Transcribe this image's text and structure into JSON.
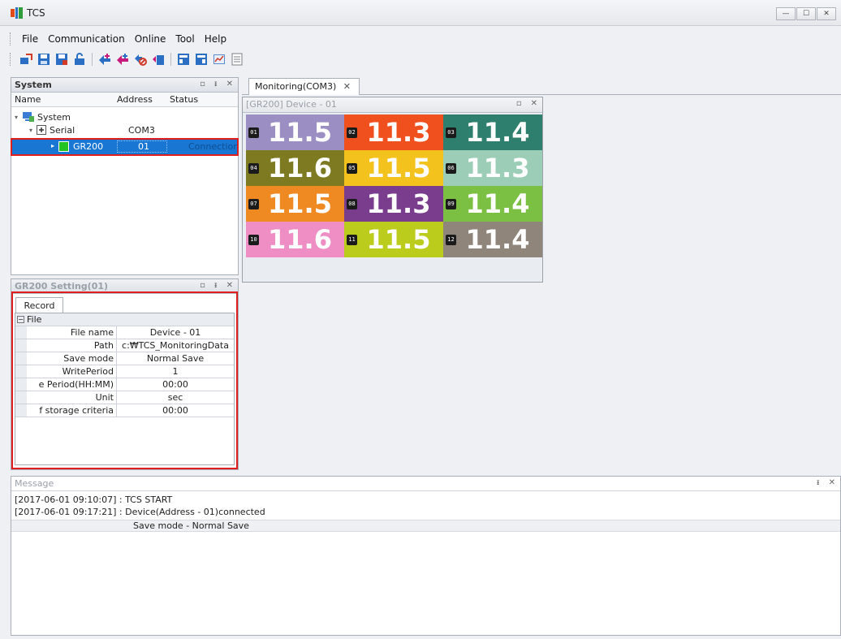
{
  "window": {
    "title": "TCS",
    "buttons": [
      "—",
      "☐",
      "✕"
    ]
  },
  "menu": [
    "File",
    "Communication",
    "Online",
    "Tool",
    "Help"
  ],
  "toolbar": {
    "icons": [
      "connect-icon",
      "save-icon",
      "save-as-icon",
      "unlock-icon",
      "add-device-icon",
      "add-multiple-icon",
      "remove-device-icon",
      "monitor-add-icon",
      "view-1-icon",
      "view-2-icon",
      "chart-icon",
      "list-icon"
    ],
    "colors": {
      "blue": "#2a6fc4",
      "magenta": "#c8197c",
      "green": "#2f9e3a",
      "red": "#d23a2a"
    }
  },
  "system_panel": {
    "title": "System",
    "controls": [
      "▫",
      "ᵻ",
      "✕"
    ],
    "columns": [
      "Name",
      "Address",
      "Status"
    ],
    "tree": {
      "root": "System",
      "serial": {
        "name": "Serial",
        "address": "COM3"
      },
      "device": {
        "name": "GR200",
        "address": "01",
        "status": "Connection"
      }
    }
  },
  "setting_panel": {
    "title": "GR200 Setting(01)",
    "controls": [
      "▫",
      "ᵻ",
      "✕"
    ],
    "tab": "Record",
    "category": "File",
    "rows": [
      {
        "name": "File name",
        "value": "Device - 01"
      },
      {
        "name": "Path",
        "value": "c:₩TCS_MonitoringData"
      },
      {
        "name": "Save mode",
        "value": "Normal Save"
      },
      {
        "name": "WritePeriod",
        "value": "1"
      },
      {
        "name": "e Period(HH:MM)",
        "value": "00:00"
      },
      {
        "name": "Unit",
        "value": "sec"
      },
      {
        "name": "f storage criteria",
        "value": "00:00"
      }
    ]
  },
  "monitoring": {
    "tab": "Monitoring(COM3)",
    "tab_close": "✕",
    "device_window": {
      "title": "[GR200] Device - 01",
      "controls": [
        "▫",
        "✕"
      ],
      "tiles": [
        {
          "channel": "01",
          "value": "11.5",
          "color": "#9a8ec2"
        },
        {
          "channel": "02",
          "value": "11.3",
          "color": "#f0501e"
        },
        {
          "channel": "03",
          "value": "11.4",
          "color": "#2e7f6e"
        },
        {
          "channel": "04",
          "value": "11.6",
          "color": "#7e7a22"
        },
        {
          "channel": "05",
          "value": "11.5",
          "color": "#f4c21c"
        },
        {
          "channel": "06",
          "value": "11.3",
          "color": "#9ccdb7"
        },
        {
          "channel": "07",
          "value": "11.5",
          "color": "#ef8a22"
        },
        {
          "channel": "08",
          "value": "11.3",
          "color": "#7a3c8c"
        },
        {
          "channel": "09",
          "value": "11.4",
          "color": "#7bc043"
        },
        {
          "channel": "10",
          "value": "11.6",
          "color": "#ef8ec4"
        },
        {
          "channel": "11",
          "value": "11.5",
          "color": "#bccc1c"
        },
        {
          "channel": "12",
          "value": "11.4",
          "color": "#8f857b"
        }
      ]
    }
  },
  "message_panel": {
    "title": "Message",
    "controls": [
      "ᵻ",
      "✕"
    ],
    "lines": [
      "[2017-06-01 09:10:07] : TCS START",
      "[2017-06-01 09:17:21] : Device(Address - 01)connected"
    ],
    "subline": "Save mode - Normal Save"
  }
}
